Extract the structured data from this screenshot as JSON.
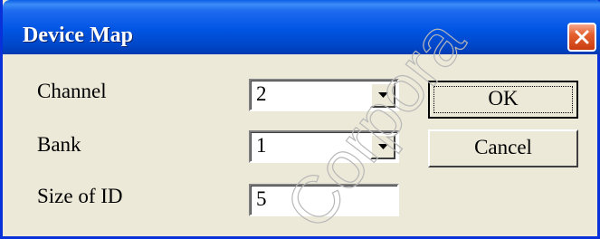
{
  "window": {
    "title": "Device Map"
  },
  "form": {
    "channel": {
      "label": "Channel",
      "value": "2"
    },
    "bank": {
      "label": "Bank",
      "value": "1"
    },
    "size_of_id": {
      "label": "Size of ID",
      "value": "5"
    }
  },
  "buttons": {
    "ok_label": "OK",
    "cancel_label": "Cancel"
  },
  "watermark": {
    "text": "Corpora"
  },
  "colors": {
    "titlebar": "#0054e3",
    "dialog_bg": "#ece9d8",
    "close_button": "#e5602e"
  },
  "icons": {
    "close": "close-icon",
    "dropdown": "chevron-down-icon"
  }
}
